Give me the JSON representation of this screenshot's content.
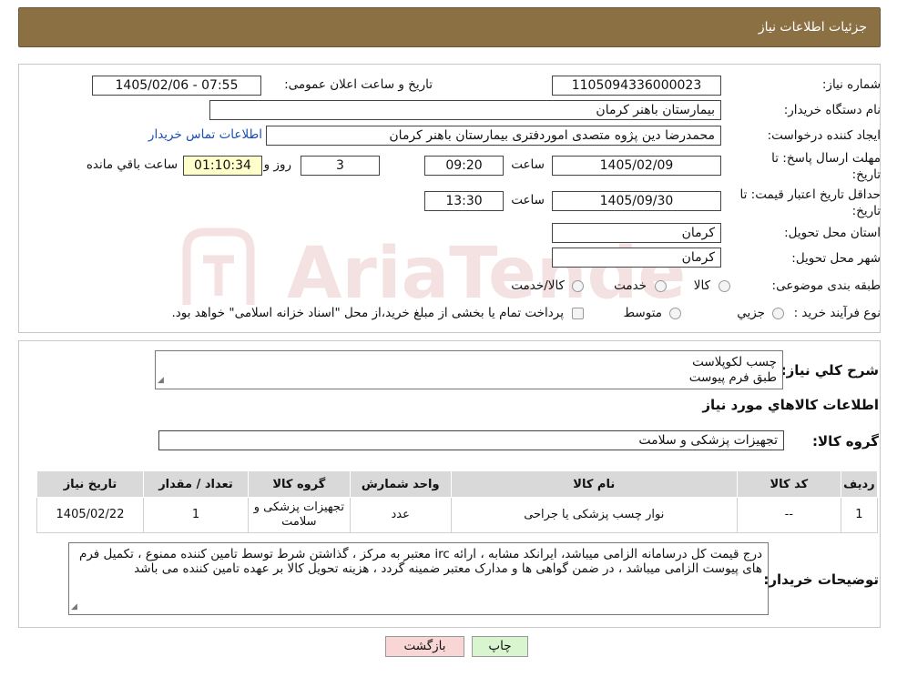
{
  "header": {
    "title": "جزئیات اطلاعات نیاز"
  },
  "fields": {
    "need_number_label": "شماره نیاز:",
    "need_number": "1105094336000023",
    "announce_label": "تاریخ و ساعت اعلان عمومی:",
    "announce_value": "1405/02/06 - 07:55",
    "buyer_org_label": "نام دستگاه خریدار:",
    "buyer_org": "بیمارستان باهنر کرمان",
    "creator_label": "ایجاد کننده درخواست:",
    "creator": "محمدرضا  دین پژوه متصدی اموردفتری بیمارستان باهنر کرمان",
    "contact_link": "اطلاعات تماس خریدار",
    "deadline_label": "مهلت ارسال پاسخ: تا تاریخ:",
    "deadline_date": "1405/02/09",
    "time_word": "ساعت",
    "deadline_time": "09:20",
    "days_value": "3",
    "days_word": "روز و",
    "remaining_time": "01:10:34",
    "remaining_word": "ساعت باقي مانده",
    "validity_label": "حداقل تاریخ اعتبار قیمت: تا تاریخ:",
    "validity_date": "1405/09/30",
    "validity_time": "13:30",
    "province_label": "استان محل تحویل:",
    "province": "کرمان",
    "city_label": "شهر محل تحویل:",
    "city": "کرمان",
    "category_label": "طبقه بندی موضوعی:",
    "category_options": [
      "کالا",
      "خدمت",
      "کالا/خدمت"
    ],
    "process_label": "نوع فرآیند خرید :",
    "process_options": [
      "جزیي",
      "متوسط"
    ],
    "process_note": "پرداخت تمام یا بخشی از مبلغ خرید،از محل \"اسناد خزانه اسلامی\" خواهد بود."
  },
  "summary": {
    "label": "شرح کلي نياز:",
    "line1": "چسب لکوپلاست",
    "line2": "طبق فرم پیوست"
  },
  "goods": {
    "section_title": "اطلاعات کالاهاي مورد نياز",
    "group_label": "گروه کالا:",
    "group_value": "تجهیزات پزشکی و سلامت",
    "columns": [
      "ردیف",
      "کد کالا",
      "نام کالا",
      "واحد شمارش",
      "گروه کالا",
      "تعداد / مقدار",
      "تاریخ نیاز"
    ],
    "rows": [
      {
        "row": "1",
        "code": "--",
        "name": "نوار چسب پزشکی یا جراحی",
        "unit": "عدد",
        "group": "تجهیزات پزشکی و سلامت",
        "qty": "1",
        "date": "1405/02/22"
      }
    ]
  },
  "buyer_notes": {
    "label": "توضیحات خریدار:",
    "text": "درج قیمت کل درسامانه الزامی میباشد، ایرانکد مشابه ، ارائه irc معتبر به مرکز ، گذاشتن شرط توسط تامین کننده ممنوع ، تکمیل فرم های پیوست الزامی میباشد ، در ضمن گواهی ها و مدارک معتبر ضمینه گردد ، هزینه تحویل کالا بر عهده تامین کننده می باشد"
  },
  "buttons": {
    "print": "چاپ",
    "back": "بازگشت"
  },
  "watermark": {
    "text": "AriaTender.neT"
  },
  "colors": {
    "header_bg": "#8b7044",
    "yellow_box": "#ffffcc",
    "print_btn": "#d9f5d0",
    "back_btn": "#f9d6d6",
    "link": "#1a4fb0"
  }
}
